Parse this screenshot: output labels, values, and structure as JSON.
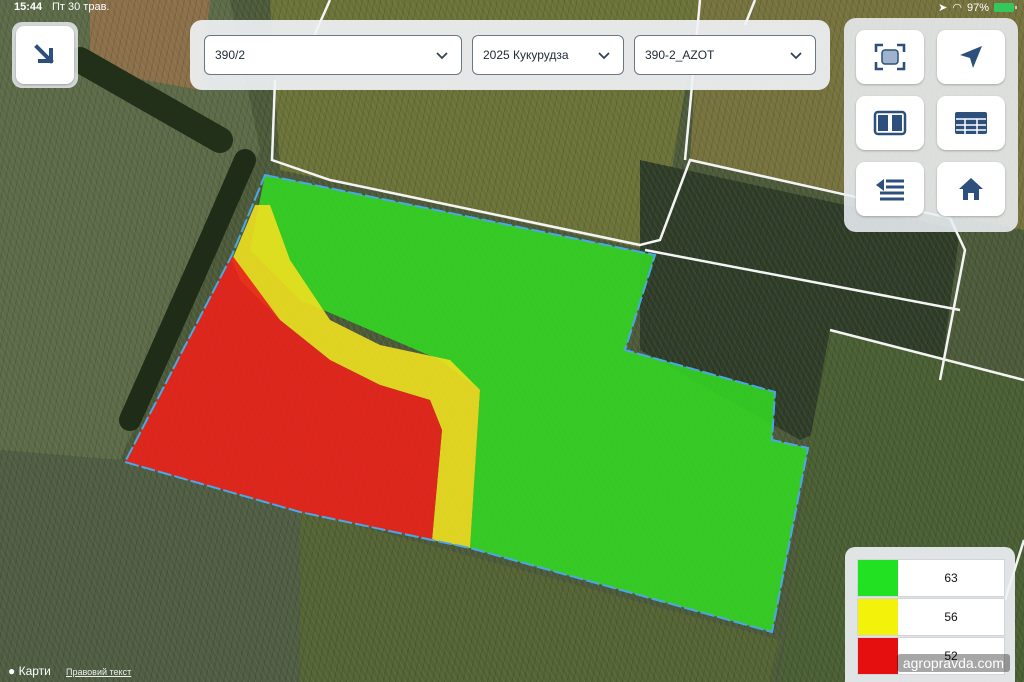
{
  "status_bar": {
    "time": "15:44",
    "date": "Пт 30 трав.",
    "battery": "97%"
  },
  "toolbar": {
    "field_select": "390/2",
    "season_crop_select": "2025 Кукурудза",
    "map_select": "390-2_AZOT"
  },
  "buttons": {
    "collapse": "arrow-down-right-icon",
    "fit_field": "fit-screen-icon",
    "location": "navigation-arrow-icon",
    "split_view": "split-view-icon",
    "table": "table-icon",
    "layers_back": "list-back-icon",
    "home": "home-icon"
  },
  "legend": [
    {
      "color": "#22e022",
      "value": "63"
    },
    {
      "color": "#f2f20a",
      "value": "56"
    },
    {
      "color": "#e60f0f",
      "value": "52"
    }
  ],
  "footer": {
    "maps_brand": "Карти",
    "legal_text": "Правовий текст",
    "watermark": "agropravda.com"
  },
  "colors": {
    "zone_high": "#33dd22",
    "zone_mid": "#f0e020",
    "zone_low": "#e8231b",
    "field_border": "#4aa8e8",
    "accent": "#2d4f7c"
  }
}
